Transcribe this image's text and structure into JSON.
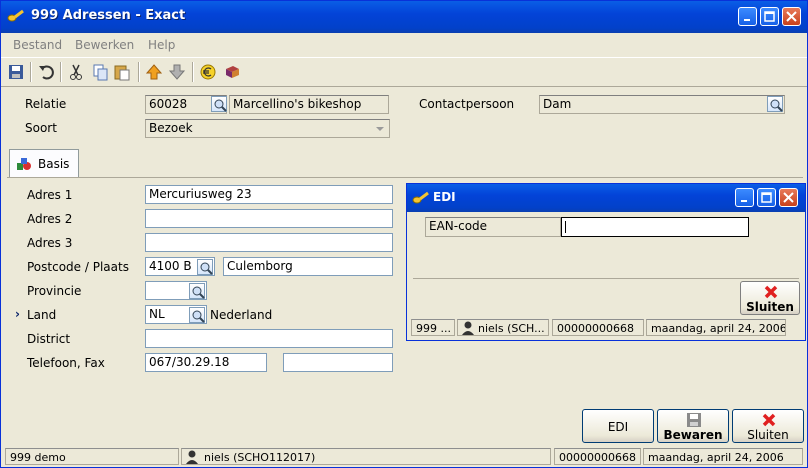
{
  "window": {
    "title": "999 Adressen - Exact"
  },
  "menu": [
    {
      "label": "Bestand"
    },
    {
      "label": "Bewerken"
    },
    {
      "label": "Help"
    }
  ],
  "header": {
    "relatie_label": "Relatie",
    "relatie_code": "60028",
    "relatie_name": "Marcellino's bikeshop",
    "soort_label": "Soort",
    "soort_value": "Bezoek",
    "contact_label": "Contactpersoon",
    "contact_value": "Dam"
  },
  "tab": {
    "label": "Basis"
  },
  "form": {
    "adres1_label": "Adres 1",
    "adres1_value": "Mercuriusweg 23",
    "adres2_label": "Adres 2",
    "adres2_value": "",
    "adres3_label": "Adres 3",
    "adres3_value": "",
    "postcode_label": "Postcode / Plaats",
    "postcode_value": "4100 B",
    "plaats_value": "Culemborg",
    "provincie_label": "Provincie",
    "provincie_value": "",
    "land_label": "Land",
    "land_marker": "›",
    "land_code": "NL",
    "land_name": "Nederland",
    "district_label": "District",
    "district_value": "",
    "telefoon_label": "Telefoon, Fax",
    "telefoon_value": "067/30.29.18",
    "fax_value": ""
  },
  "buttons": {
    "edi": "EDI",
    "bewaren": "Bewaren",
    "sluiten": "Sluiten"
  },
  "status": {
    "company": "999 demo",
    "user": "niels (SCHO112017)",
    "number": "00000000668",
    "date": "maandag, april 24, 2006"
  },
  "edi_dialog": {
    "title": "EDI",
    "ean_label": "EAN-code",
    "ean_value": "",
    "sluiten": "Sluiten",
    "status_company": "999 ...",
    "status_user": "niels (SCH...",
    "status_number": "00000000668",
    "status_date": "maandag, april 24, 2006"
  },
  "colors": {
    "title_blue": "#0343d8",
    "face": "#ece9d8",
    "field_border": "#7f9db9",
    "close_red": "#c8401c"
  }
}
